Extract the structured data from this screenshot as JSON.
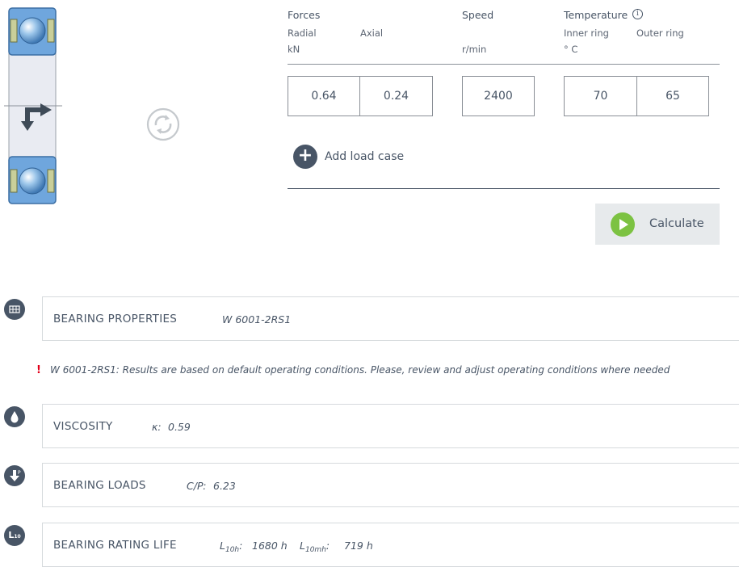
{
  "header": {
    "forces": "Forces",
    "radial": "Radial",
    "axial": "Axial",
    "forces_unit": "kN",
    "speed": "Speed",
    "speed_unit": "r/min",
    "temperature": "Temperature",
    "info_glyph": "i",
    "inner_ring": "Inner ring",
    "outer_ring": "Outer ring",
    "temp_unit": "° C"
  },
  "inputs": {
    "radial": "0.64",
    "axial": "0.24",
    "speed": "2400",
    "inner_ring": "70",
    "outer_ring": "65"
  },
  "add_load_case": {
    "glyph": "+",
    "label": "Add load case"
  },
  "calculate": {
    "label": "Calculate"
  },
  "sections": {
    "properties": {
      "title": "BEARING PROPERTIES",
      "value": "W 6001-2RS1",
      "icon": "table-icon"
    },
    "warning": {
      "mark": "!",
      "text": "W 6001-2RS1: Results are based on default operating conditions. Please, review and adjust operating conditions where needed"
    },
    "viscosity": {
      "title": "VISCOSITY",
      "symbol": "κ:",
      "value": "0.59",
      "icon": "drop-icon"
    },
    "loads": {
      "title": "BEARING LOADS",
      "label": "C/P:",
      "value": "6.23",
      "icon": "load-arrow-icon"
    },
    "rating_life": {
      "title": "BEARING RATING LIFE",
      "l10h_main": "L",
      "l10h_sub": "10h",
      "l10h_colon": ":",
      "l10h_value": "1680 h",
      "l10mh_main": "L",
      "l10mh_sub": "10mh",
      "l10mh_colon": ":",
      "l10mh_value": "719 h",
      "icon": "life-icon",
      "icon_main": "L",
      "icon_sub": "10"
    }
  },
  "colors": {
    "text": "#485566",
    "accent_green": "#7cc242",
    "warning_red": "#e2001a",
    "bearing_blue": "#5b9bd5"
  }
}
